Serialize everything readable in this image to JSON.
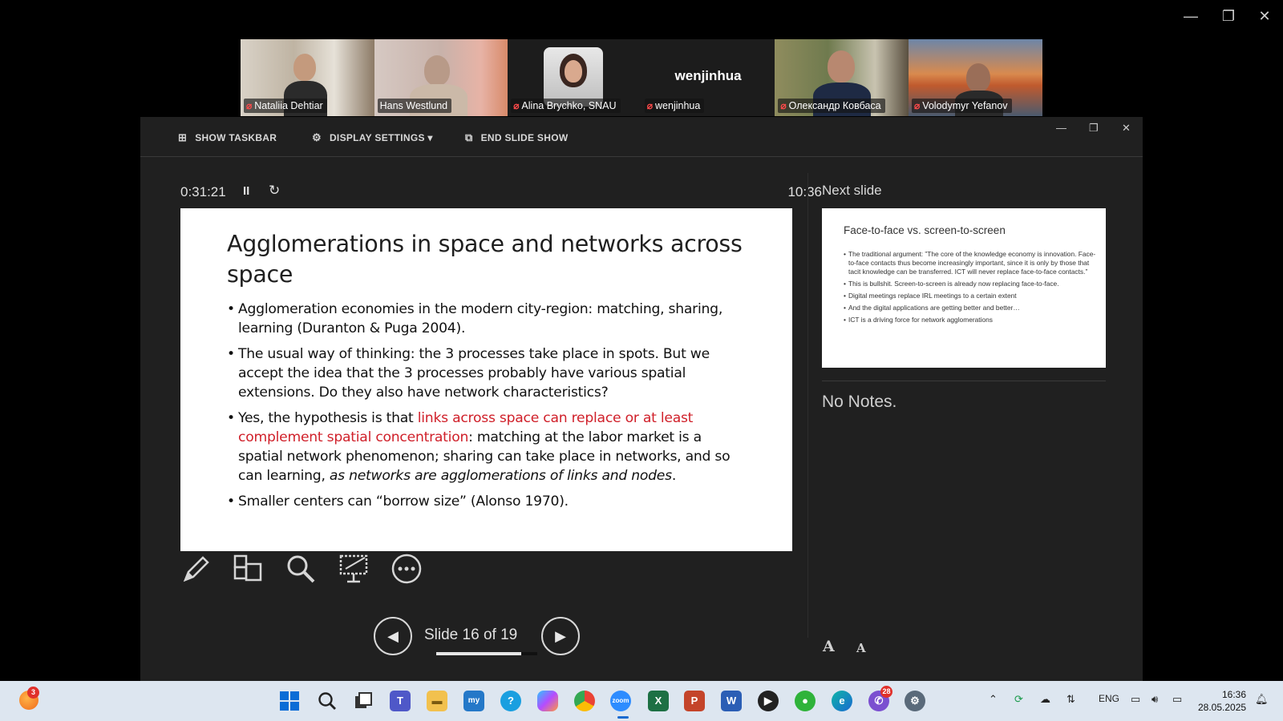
{
  "window_controls": {
    "minimize": "—",
    "restore": "❐",
    "close": "✕"
  },
  "participants": [
    {
      "name": "Nataliia Dehtiar",
      "muted": true,
      "active": false
    },
    {
      "name": "Hans Westlund",
      "muted": false,
      "active": true
    },
    {
      "name": "Alina Brychko, SNAU",
      "muted": true,
      "active": false
    },
    {
      "name": "wenjinhua",
      "display_label": "wenjinhua",
      "muted": true,
      "active": false
    },
    {
      "name": "Олександр Ковбаса",
      "muted": true,
      "active": false
    },
    {
      "name": "Volodymyr Yefanov",
      "muted": true,
      "active": false
    }
  ],
  "presenter": {
    "toolbar": {
      "show_taskbar": "SHOW TASKBAR",
      "display_settings": "DISPLAY SETTINGS ▾",
      "end_slide_show": "END SLIDE SHOW"
    },
    "window_controls": {
      "minimize": "—",
      "restore": "❐",
      "close": "✕"
    },
    "elapsed": "0:31:21",
    "pause_glyph": "II",
    "reset_glyph": "↻",
    "clock": "10:36",
    "current_slide": {
      "title": "Agglomerations in space and networks across space",
      "bullets": [
        {
          "text": "Agglomeration economies in the modern city-region: matching, sharing, learning (Duranton & Puga 2004)."
        },
        {
          "text": "The usual way of thinking: the 3 processes take place in spots. But we accept the idea that the 3 processes probably have various spatial extensions. Do they also have network characteristics?"
        },
        {
          "prefix": "Yes, the hypothesis is that ",
          "highlight": "links across space can replace or at least complement spatial concentration",
          "middle": ": matching at the labor market is a spatial network phenomenon; sharing can take place in networks, and so can learning, ",
          "italic": "as networks are agglomerations of links and nodes",
          "suffix": "."
        },
        {
          "text": "Smaller centers can “borrow size” (Alonso 1970)."
        }
      ]
    },
    "tools": [
      "pen-icon",
      "grid-icon",
      "zoom-icon",
      "subtitles-icon",
      "more-icon"
    ],
    "nav": {
      "prev": "◀",
      "next": "▶",
      "slide_counter": "Slide 16 of 19",
      "progress_fraction": 0.84
    },
    "next_slide_label": "Next slide",
    "next_slide": {
      "title": "Face-to-face vs. screen-to-screen",
      "bullets": [
        "The traditional argument: ”The core of the knowledge economy is innovation. Face-to-face contacts thus become increasingly important, since it is only by those that tacit knowledge can be transferred. ICT will never replace face-to-face contacts.”",
        "This is bullshit. Screen-to-screen is already now replacing face-to-face.",
        "Digital meetings replace IRL meetings to a certain extent",
        "And the digital applications are getting better and better…",
        "ICT is a driving force for network agglomerations"
      ]
    },
    "notes": "No Notes.",
    "font_increase": "A",
    "font_decrease": "A"
  },
  "taskbar": {
    "badges": {
      "left_app": "3",
      "viber": "28"
    },
    "language": "ENG",
    "time": "16:36",
    "date": "28.05.2025",
    "colors": {
      "start": "#0a6cd6",
      "excel": "#1d7044",
      "powerpoint": "#c4442a",
      "word": "#2b5eb5",
      "zoom": "#2d8cff",
      "teams": "#4f58c8"
    }
  }
}
